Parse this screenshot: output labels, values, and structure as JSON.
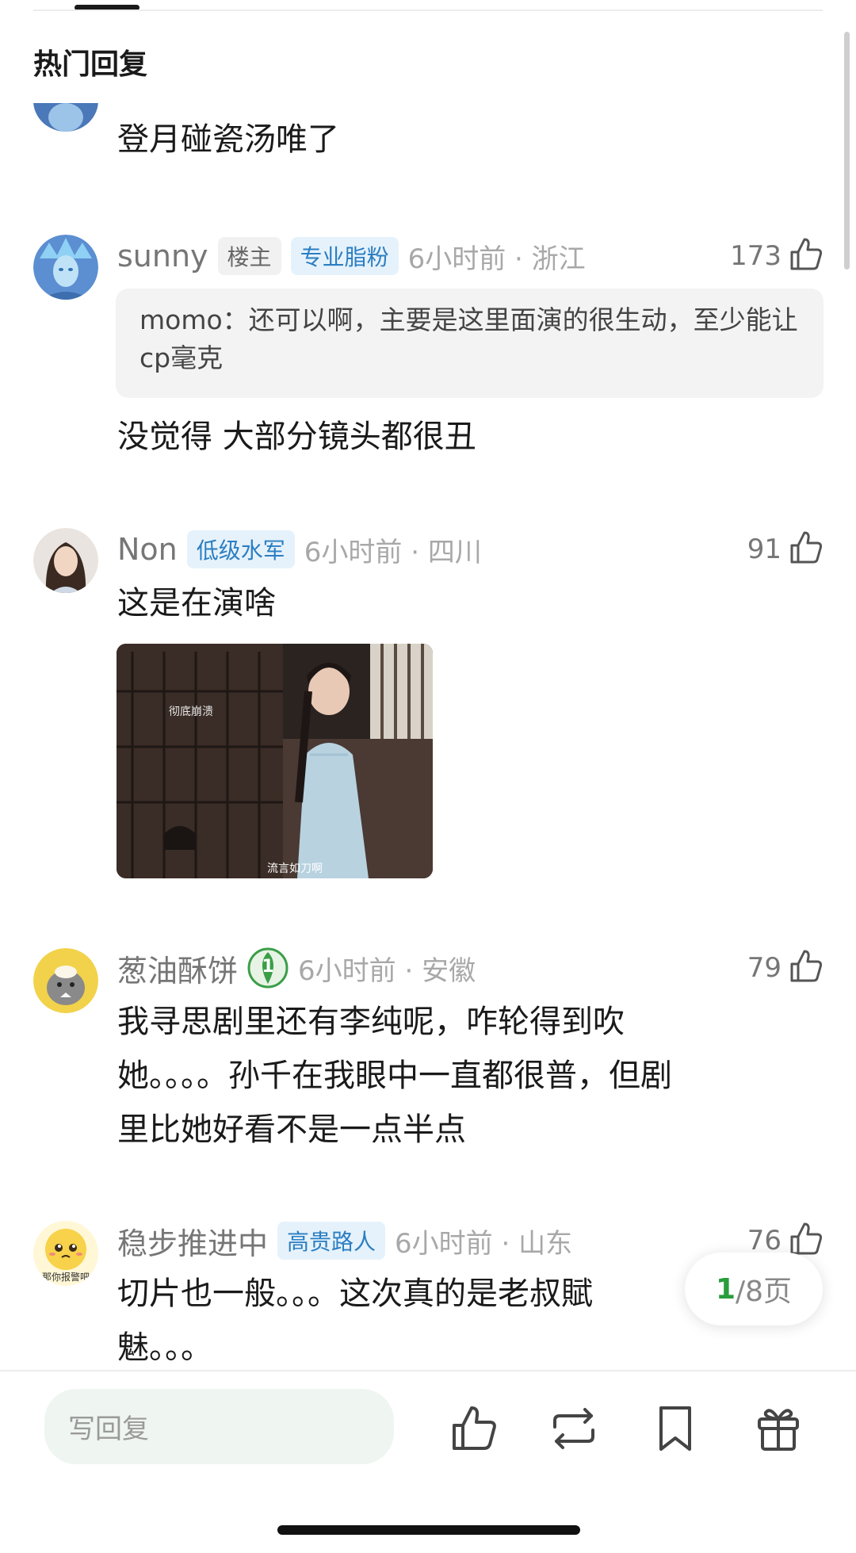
{
  "section_title": "热门回复",
  "comments": [
    {
      "text": "登月碰瓷汤唯了"
    },
    {
      "username": "sunny",
      "badges": [
        "楼主",
        "专业脂粉"
      ],
      "time_location": "6小时前 · 浙江",
      "likes": "173",
      "quote": "momo：还可以啊，主要是这里面演的很生动，至少能让cp毫克",
      "text": "没觉得 大部分镜头都很丑"
    },
    {
      "username": "Non",
      "badges": [
        "低级水军"
      ],
      "time_location": "6小时前 · 四川",
      "likes": "91",
      "text": "这是在演啥",
      "image_captions": [
        "彻底崩溃",
        "流言如刀啊"
      ]
    },
    {
      "username": "葱油酥饼",
      "level_badge": "1",
      "time_location": "6小时前 · 安徽",
      "likes": "79",
      "text_lines": [
        "我寻思剧里还有李纯呢，咋轮得到吹",
        "她。。。。孙千在我眼中一直都很普，但剧",
        "里比她好看不是一点半点"
      ]
    },
    {
      "username": "稳步推进中",
      "badges": [
        "高贵路人"
      ],
      "time_location": "6小时前 · 山东",
      "likes": "76",
      "avatar_caption": "那你报警吧",
      "text_lines": [
        "切片也一般。。。这次真的是老叔賦",
        "魅。。。"
      ]
    }
  ],
  "pagination": {
    "current": "1",
    "total_suffix": "/8页"
  },
  "bottom_bar": {
    "reply_placeholder": "写回复"
  },
  "icons": [
    "like-icon",
    "repost-icon",
    "bookmark-icon",
    "gift-icon"
  ],
  "colors": {
    "accent_green": "#2a9d3c",
    "badge_blue": "#2b7ec2"
  }
}
